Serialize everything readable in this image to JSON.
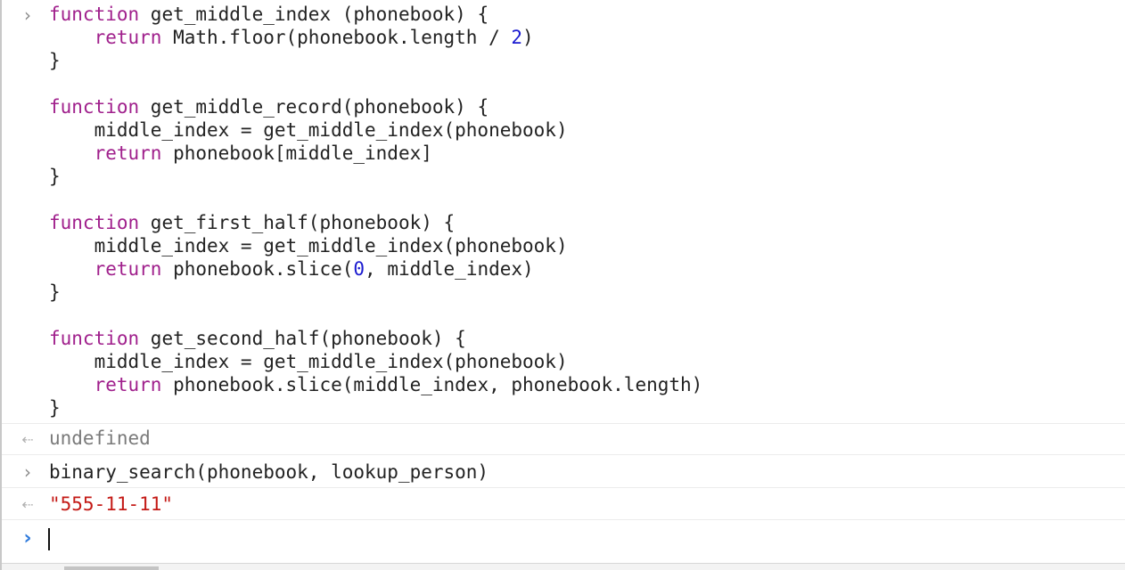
{
  "console": {
    "code_entry": {
      "lines": [
        [
          "function",
          " get_middle_index (phonebook) {"
        ],
        [
          "    ",
          "return",
          " Math.floor(phonebook.length / ",
          "2",
          ")"
        ],
        [
          "}"
        ],
        [
          "function",
          " get_middle_record(phonebook) {"
        ],
        [
          "    middle_index = get_middle_index(phonebook)"
        ],
        [
          "    ",
          "return",
          " phonebook[middle_index]"
        ],
        [
          "}"
        ],
        [
          "function",
          " get_first_half(phonebook) {"
        ],
        [
          "    middle_index = get_middle_index(phonebook)"
        ],
        [
          "    ",
          "return",
          " phonebook.slice(",
          "0",
          ", middle_index)"
        ],
        [
          "}"
        ],
        [
          "function",
          " get_second_half(phonebook) {"
        ],
        [
          "    middle_index = get_middle_index(phonebook)"
        ],
        [
          "    ",
          "return",
          " phonebook.slice(middle_index, phonebook.length)"
        ],
        [
          "}"
        ]
      ]
    },
    "result_1": "undefined",
    "command_2": "binary_search(phonebook, lookup_person)",
    "result_2": "\"555-11-11\"",
    "prompt_input_value": "",
    "icons": {
      "input_marker": "chevron-right-icon",
      "output_marker": "return-arrow-icon",
      "prompt_marker": "prompt-chevron-icon"
    },
    "colors": {
      "keyword": "#a0208c",
      "number": "#1b1bd0",
      "string": "#c41a16",
      "prompt": "#2f7bdc",
      "muted": "#7a7a7a"
    }
  }
}
